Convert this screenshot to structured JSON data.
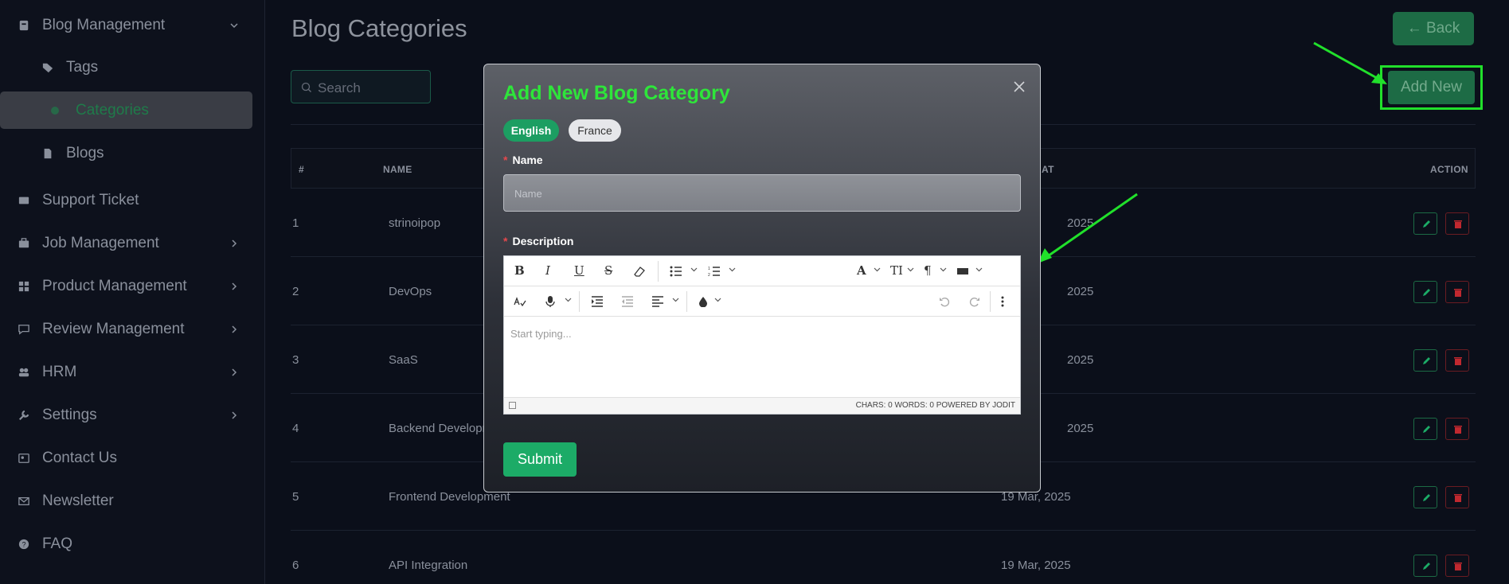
{
  "sidebar": {
    "items": [
      {
        "label": "Blog Management",
        "icon": "document-icon",
        "chevron": "down"
      },
      {
        "label": "Tags",
        "icon": "tags-icon",
        "sub": true
      },
      {
        "label": "Categories",
        "icon": "circle-icon",
        "sub": true,
        "active": true
      },
      {
        "label": "Blogs",
        "icon": "file-icon",
        "sub": true
      },
      {
        "label": "Support Ticket",
        "icon": "ticket-icon"
      },
      {
        "label": "Job Management",
        "icon": "briefcase-icon",
        "chevron": "right"
      },
      {
        "label": "Product Management",
        "icon": "grid-icon",
        "chevron": "right"
      },
      {
        "label": "Review Management",
        "icon": "chat-icon",
        "chevron": "right"
      },
      {
        "label": "HRM",
        "icon": "users-icon",
        "chevron": "right"
      },
      {
        "label": "Settings",
        "icon": "wrench-icon",
        "chevron": "right"
      },
      {
        "label": "Contact Us",
        "icon": "contact-card-icon"
      },
      {
        "label": "Newsletter",
        "icon": "envelope-icon"
      },
      {
        "label": "FAQ",
        "icon": "question-icon"
      }
    ]
  },
  "header": {
    "title": "Blog Categories",
    "back_label": "← Back",
    "add_new_label": "Add New",
    "search_placeholder": "Search"
  },
  "table": {
    "headers": {
      "num": "#",
      "name": "NAME",
      "created": "AT",
      "action": "ACTION"
    },
    "rows": [
      {
        "num": "1",
        "name": "strinoipop",
        "date": "2025"
      },
      {
        "num": "2",
        "name": "DevOps",
        "date": "2025"
      },
      {
        "num": "3",
        "name": "SaaS",
        "date": "2025"
      },
      {
        "num": "4",
        "name": "Backend Developm",
        "date": "2025"
      },
      {
        "num": "5",
        "name": "Frontend Development",
        "date": "19 Mar, 2025"
      },
      {
        "num": "6",
        "name": "API Integration",
        "date": "19 Mar, 2025"
      }
    ]
  },
  "modal": {
    "title": "Add New Blog Category",
    "tabs": [
      "English",
      "France"
    ],
    "name_label": "Name",
    "name_placeholder": "Name",
    "description_label": "Description",
    "editor_placeholder": "Start typing...",
    "editor_status": "CHARS: 0   WORDS: 0   POWERED BY JODIT",
    "submit_label": "Submit"
  },
  "colors": {
    "accent": "#1cab67",
    "highlight": "#21e02b",
    "danger": "#e5484d"
  }
}
